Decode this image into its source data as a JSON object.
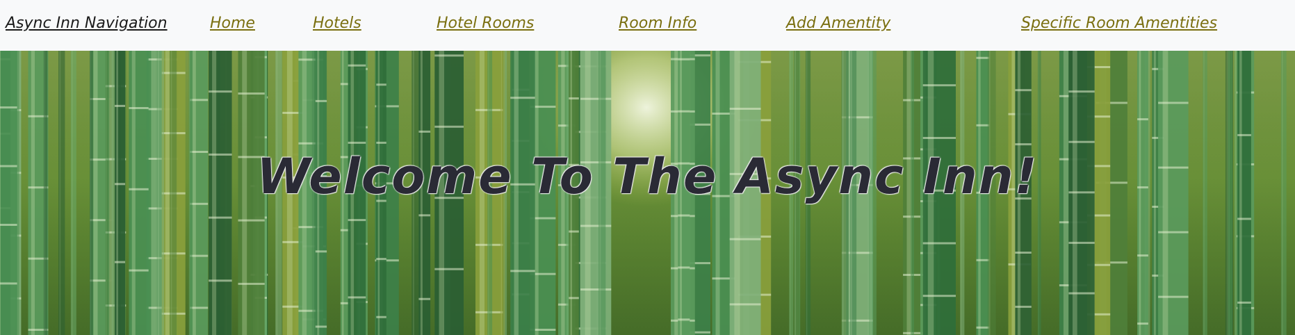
{
  "nav": {
    "brand": "Async Inn Navigation",
    "links": [
      "Home",
      "Hotels",
      "Hotel Rooms",
      "Room Info",
      "Add Amentity",
      "Specific Room Amentities"
    ]
  },
  "hero": {
    "title": "Welcome To The Async Inn!",
    "image": "bamboo-forest"
  },
  "colors": {
    "navbar_bg": "#f8f9fa",
    "link": "#7a6f10",
    "brand": "#1a1a1a",
    "title": "#2a2a35"
  }
}
